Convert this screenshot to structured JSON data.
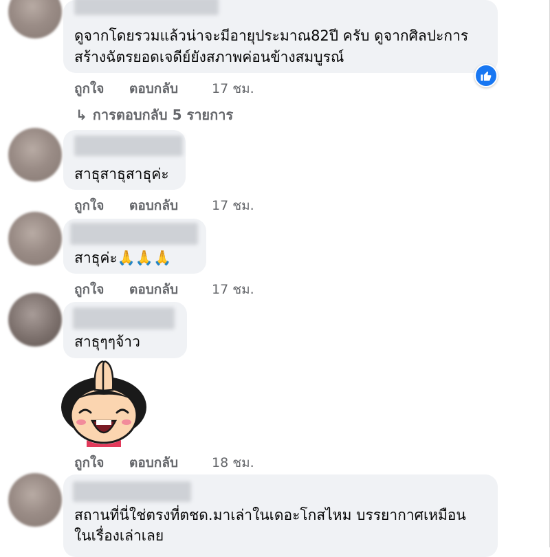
{
  "comments": [
    {
      "text_lines": [
        "ดูจากโดยรวมแล้วน่าจะมีอายุประมาณ82ปี ครับ ดูจากศิลปะการ",
        "สร้างฉัตรยอดเจดีย์ยังสภาพค่อนข้างสมบูรณ์"
      ],
      "like": "ถูกใจ",
      "reply": "ตอบกลับ",
      "time": "17 ชม.",
      "reaction": "like-icon",
      "replies_link": "การตอบกลับ 5 รายการ"
    },
    {
      "text_lines": [
        "สาธุสาธุสาธุค่ะ"
      ],
      "like": "ถูกใจ",
      "reply": "ตอบกลับ",
      "time": "17 ชม."
    },
    {
      "text": "สาธุค่ะ",
      "emoji": "🙏🙏🙏",
      "like": "ถูกใจ",
      "reply": "ตอบกลับ",
      "time": "17 ชม."
    },
    {
      "text_lines": [
        "สาธุๆๆจ้าว"
      ],
      "sticker": "praying-girl-sticker",
      "like": "ถูกใจ",
      "reply": "ตอบกลับ",
      "time": "18 ชม."
    },
    {
      "text_lines": [
        "สถานที่นี่ใช่ตรงที่ตชด.มาเล่าในเดอะโกสไหม บรรยากาศเหมือน",
        "ในเรื่องเล่าเลย"
      ]
    }
  ],
  "colors": {
    "bubble": "#f0f2f5",
    "meta": "#65676b",
    "like_blue": "#1877f2"
  }
}
